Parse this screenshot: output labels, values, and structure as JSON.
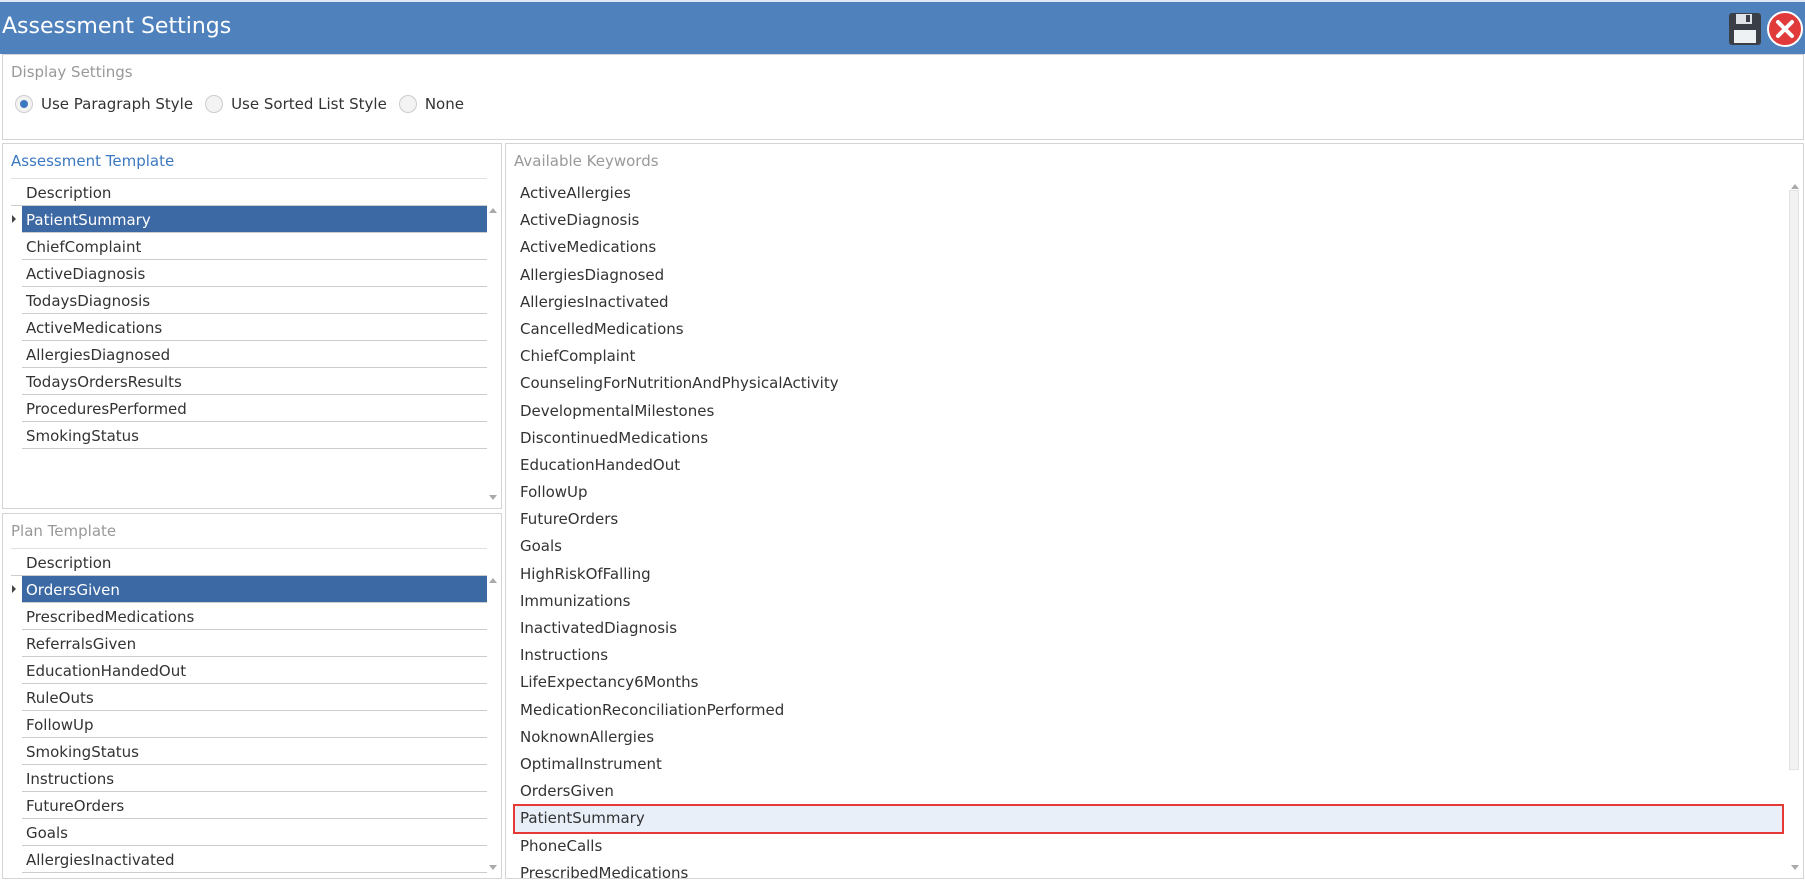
{
  "window": {
    "title": "Assessment Settings"
  },
  "display_settings": {
    "title": "Display Settings",
    "options": [
      {
        "label": "Use Paragraph Style",
        "selected": true
      },
      {
        "label": "Use Sorted List Style",
        "selected": false
      },
      {
        "label": "None",
        "selected": false
      }
    ]
  },
  "assessment_template": {
    "title": "Assessment Template",
    "column": "Description",
    "rows": [
      "PatientSummary",
      "ChiefComplaint",
      "ActiveDiagnosis",
      "TodaysDiagnosis",
      "ActiveMedications",
      "AllergiesDiagnosed",
      "TodaysOrdersResults",
      "ProceduresPerformed",
      "SmokingStatus"
    ],
    "selected_index": 0
  },
  "plan_template": {
    "title": "Plan Template",
    "column": "Description",
    "rows": [
      "OrdersGiven",
      "PrescribedMedications",
      "ReferralsGiven",
      "EducationHandedOut",
      "RuleOuts",
      "FollowUp",
      "SmokingStatus",
      "Instructions",
      "FutureOrders",
      "Goals",
      "AllergiesInactivated"
    ],
    "selected_index": 0
  },
  "available_keywords": {
    "title": "Available Keywords",
    "items": [
      "ActiveAllergies",
      "ActiveDiagnosis",
      "ActiveMedications",
      "AllergiesDiagnosed",
      "AllergiesInactivated",
      "CancelledMedications",
      "ChiefComplaint",
      "CounselingForNutritionAndPhysicalActivity",
      "DevelopmentalMilestones",
      "DiscontinuedMedications",
      "EducationHandedOut",
      "FollowUp",
      "FutureOrders",
      "Goals",
      "HighRiskOfFalling",
      "Immunizations",
      "InactivatedDiagnosis",
      "Instructions",
      "LifeExpectancy6Months",
      "MedicationReconciliationPerformed",
      "NoknownAllergies",
      "OptimalInstrument",
      "OrdersGiven",
      "PatientSummary",
      "PhoneCalls",
      "PrescribedMedications"
    ],
    "highlighted_index": 23
  },
  "colors": {
    "titlebar": "#4f81bd",
    "selected_row": "#3c68a3",
    "highlight_border": "#e53935"
  }
}
